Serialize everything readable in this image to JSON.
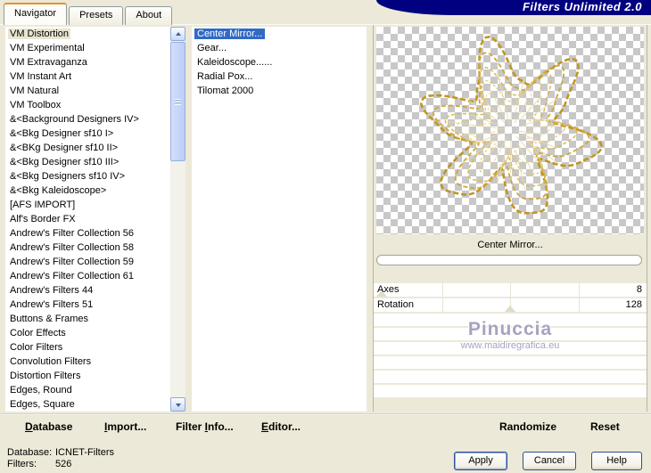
{
  "window": {
    "title": "Filters Unlimited 2.0"
  },
  "tabs": [
    {
      "label": "Navigator",
      "active": true
    },
    {
      "label": "Presets",
      "active": false
    },
    {
      "label": "About",
      "active": false
    }
  ],
  "category_list": {
    "selected_index": 0,
    "items": [
      "VM Distortion",
      "VM Experimental",
      "VM Extravaganza",
      "VM Instant Art",
      "VM Natural",
      "VM Toolbox",
      "&<Background Designers IV>",
      "&<Bkg Designer sf10 I>",
      "&<BKg Designer sf10 II>",
      "&<Bkg Designer sf10 III>",
      "&<Bkg Designers sf10 IV>",
      "&<Bkg Kaleidoscope>",
      "[AFS IMPORT]",
      "Alf's Border FX",
      "Andrew's Filter Collection 56",
      "Andrew's Filter Collection 58",
      "Andrew's Filter Collection 59",
      "Andrew's Filter Collection 61",
      "Andrew's Filters 44",
      "Andrew's Filters 51",
      "Buttons & Frames",
      "Color Effects",
      "Color Filters",
      "Convolution Filters",
      "Distortion Filters",
      "Edges, Round",
      "Edges, Square"
    ]
  },
  "filter_list": {
    "selected_index": 0,
    "items": [
      "Center Mirror...",
      "Gear...",
      "Kaleidoscope......",
      "Radial Pox...",
      "Tilomat 2000"
    ]
  },
  "preview": {
    "filter_name": "Center Mirror...",
    "watermark": {
      "name": "Pinuccia",
      "url": "www.maidiregrafica.eu"
    }
  },
  "sliders": [
    {
      "label": "Axes",
      "value": "8",
      "thumb_pct": 3
    },
    {
      "label": "Rotation",
      "value": "128",
      "thumb_pct": 50
    }
  ],
  "actions": {
    "left": [
      {
        "id": "database",
        "pre": "",
        "key": "D",
        "post": "atabase"
      },
      {
        "id": "import",
        "pre": "",
        "key": "I",
        "post": "mport..."
      },
      {
        "id": "filter-info",
        "pre": "Filter ",
        "key": "I",
        "post": "nfo..."
      },
      {
        "id": "editor",
        "pre": "",
        "key": "E",
        "post": "ditor..."
      }
    ],
    "right": [
      {
        "id": "randomize",
        "label": "Randomize"
      },
      {
        "id": "reset",
        "label": "Reset"
      }
    ]
  },
  "status": {
    "rows": [
      {
        "label": "Database:",
        "value": "ICNET-Filters"
      },
      {
        "label": "Filters:",
        "value": "526"
      }
    ]
  },
  "dialog": {
    "buttons": [
      {
        "id": "apply",
        "label": "Apply"
      },
      {
        "id": "cancel",
        "label": "Cancel"
      },
      {
        "id": "help",
        "label": "Help"
      }
    ]
  },
  "colors": {
    "banner_bg": "#000080",
    "selection_blue": "#316ac5",
    "tab_accent_orange": "#e5902a",
    "dialog_bg": "#ece9d8",
    "gold_outline": "#c79a22",
    "watermark": "#a8a2bf"
  }
}
